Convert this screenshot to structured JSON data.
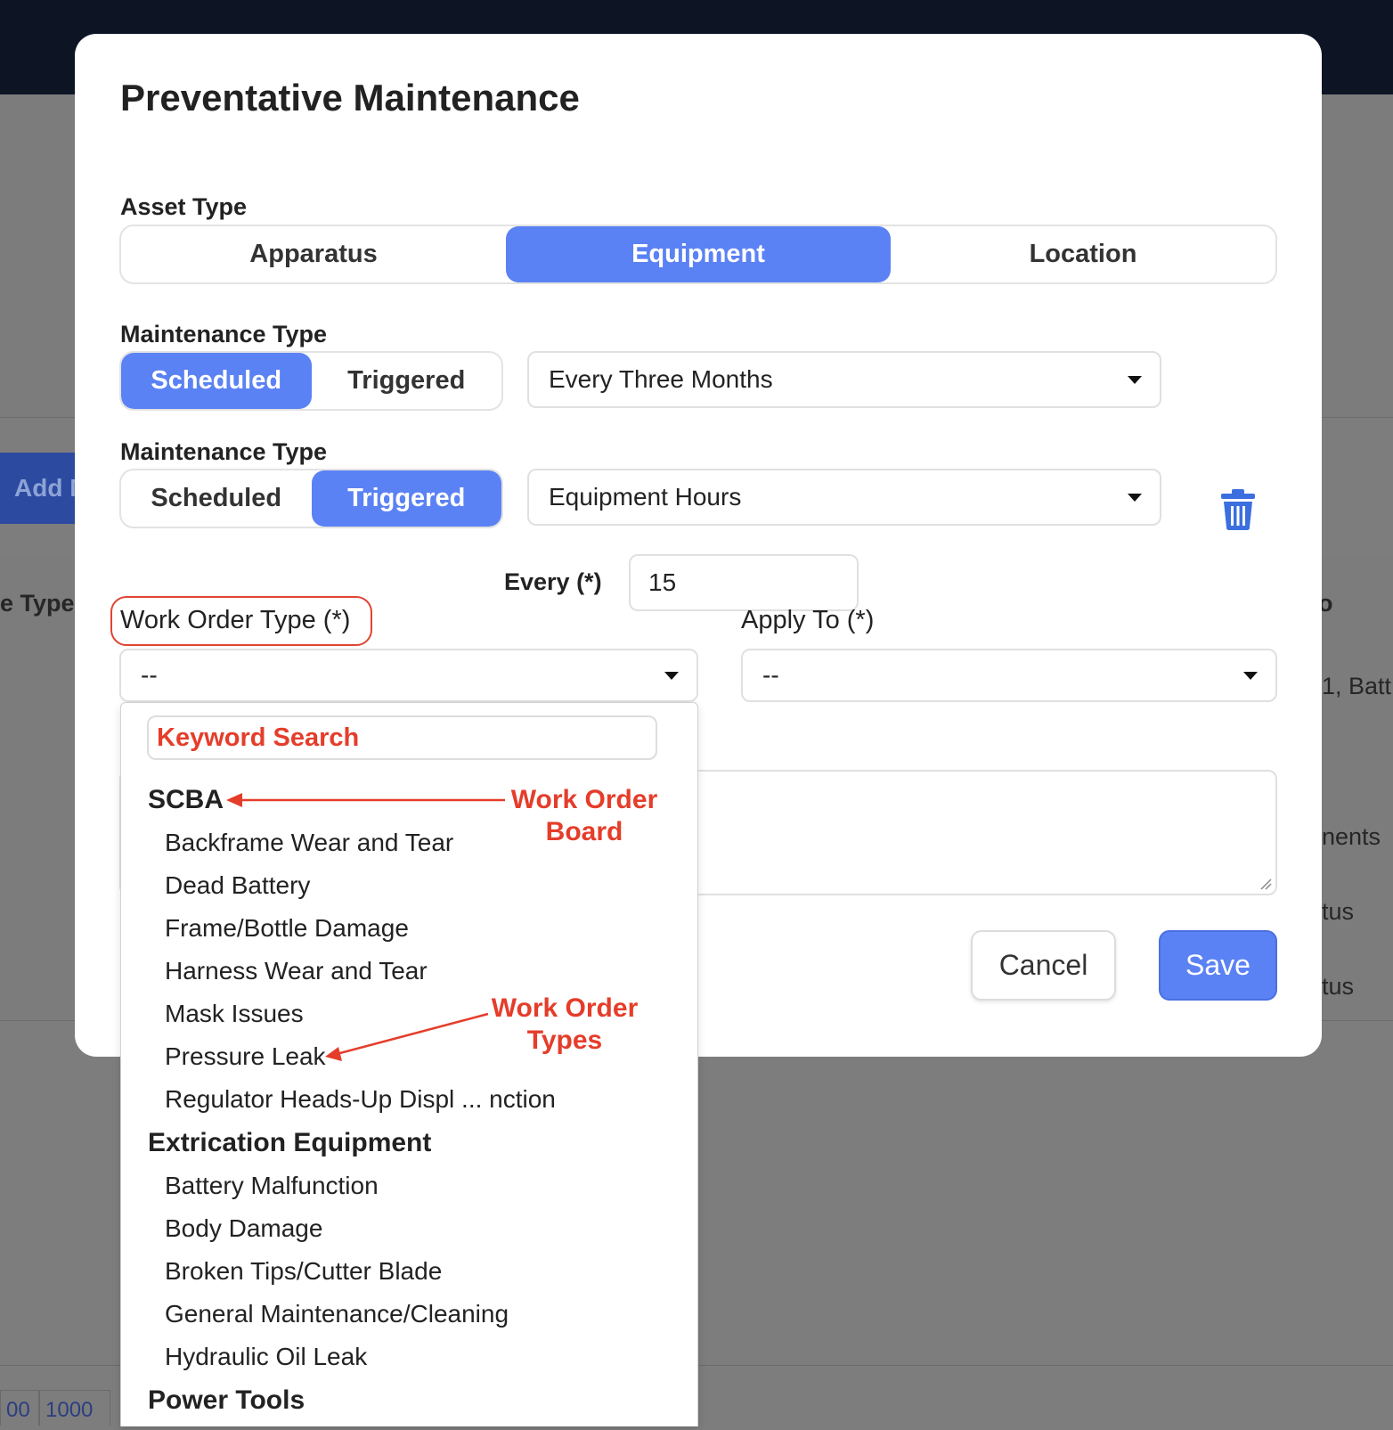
{
  "background": {
    "add_button_label": "Add M",
    "col_type_label": "e Type",
    "col_right_fragment": "o",
    "row_text_1": "1, Batt",
    "row_text_2": "nents",
    "row_text_3": "tus",
    "row_text_4": "tus",
    "pager": [
      "00",
      "1000"
    ]
  },
  "modal": {
    "title": "Preventative Maintenance",
    "asset_type": {
      "label": "Asset Type",
      "options": [
        "Apparatus",
        "Equipment",
        "Location"
      ],
      "selected": "Equipment"
    },
    "maintenance_rows": [
      {
        "label": "Maintenance Type",
        "options": [
          "Scheduled",
          "Triggered"
        ],
        "selected": "Scheduled",
        "select_value": "Every Three Months"
      },
      {
        "label": "Maintenance Type",
        "options": [
          "Scheduled",
          "Triggered"
        ],
        "selected": "Triggered",
        "select_value": "Equipment Hours"
      }
    ],
    "every": {
      "label": "Every (*)",
      "value": "15"
    },
    "work_order_type": {
      "label": "Work Order Type (*)",
      "value": "--"
    },
    "apply_to": {
      "label": "Apply To (*)",
      "value": "--"
    },
    "buttons": {
      "cancel": "Cancel",
      "save": "Save"
    }
  },
  "dropdown": {
    "search_placeholder": "Keyword Search",
    "groups": [
      {
        "name": "SCBA",
        "items": [
          "Backframe Wear and Tear",
          "Dead Battery",
          "Frame/Bottle Damage",
          "Harness Wear and Tear",
          "Mask Issues",
          "Pressure Leak",
          "Regulator Heads-Up Displ ... nction"
        ]
      },
      {
        "name": "Extrication Equipment",
        "items": [
          "Battery Malfunction",
          "Body Damage",
          "Broken Tips/Cutter Blade",
          "General Maintenance/Cleaning",
          "Hydraulic Oil Leak"
        ]
      },
      {
        "name": "Power Tools",
        "items": []
      }
    ]
  },
  "annotations": {
    "board": [
      "Work Order",
      "Board"
    ],
    "types": [
      "Work Order",
      "Types"
    ],
    "color": "#e53d2a"
  },
  "colors": {
    "accent": "#5b82f4",
    "topbar": "#0d1424",
    "annotation": "#e53d2a"
  },
  "icons": {
    "delete": "trash-icon",
    "dropdown": "chevron-down-icon"
  }
}
